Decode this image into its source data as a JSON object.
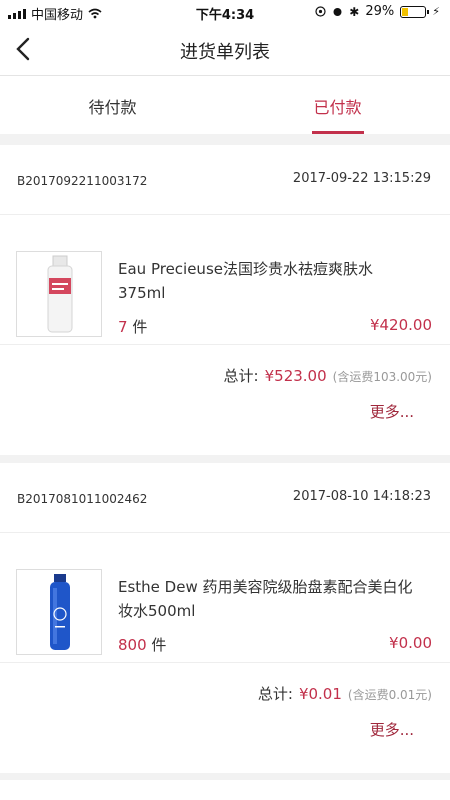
{
  "status_bar": {
    "carrier": "中国移动",
    "time": "下午4:34",
    "battery": "29%",
    "battery_level": 0.29
  },
  "nav": {
    "title": "进货单列表"
  },
  "tabs": [
    {
      "label": "待付款",
      "active": false
    },
    {
      "label": "已付款",
      "active": true
    }
  ],
  "orders": [
    {
      "order_no": "B2017092211003172",
      "time": "2017-09-22 13:15:29",
      "product_name": "Eau Precieuse法国珍贵水祛痘爽肤水375ml",
      "quantity": "7",
      "unit": "件",
      "price": "¥420.00",
      "total_label": "总计:",
      "total": "¥523.00",
      "shipping": "(含运费103.00元)",
      "more": "更多..."
    },
    {
      "order_no": "B2017081011002462",
      "time": "2017-08-10 14:18:23",
      "product_name": "Esthe Dew 药用美容院级胎盘素配合美白化妆水500ml",
      "quantity": "800",
      "unit": "件",
      "price": "¥0.00",
      "total_label": "总计:",
      "total": "¥0.01",
      "shipping": "(含运费0.01元)",
      "more": "更多..."
    }
  ],
  "colors": {
    "accent": "#c2304b",
    "background": "#f2f2f2"
  }
}
